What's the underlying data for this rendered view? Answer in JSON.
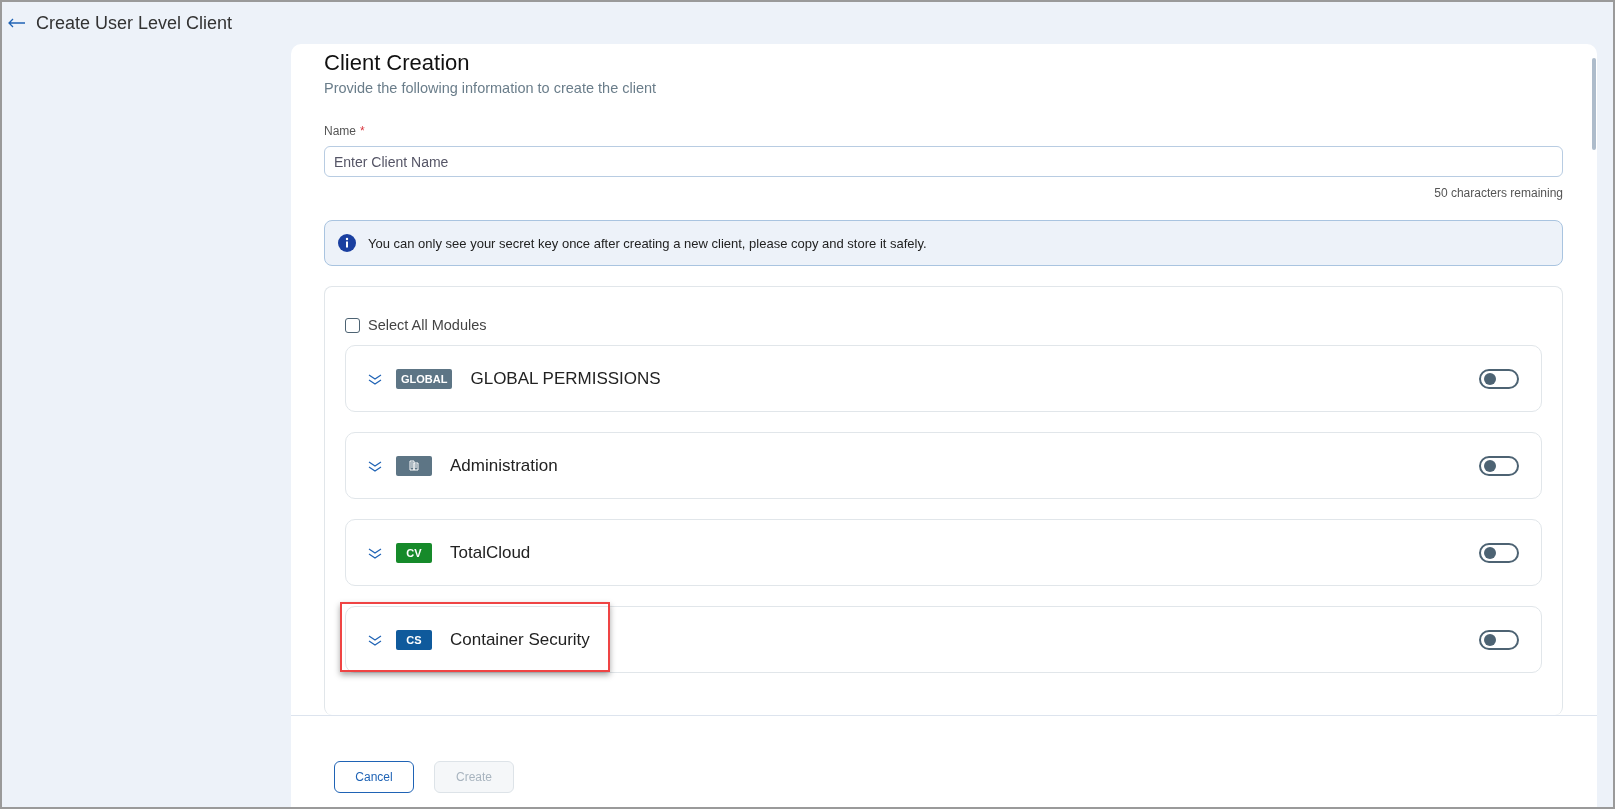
{
  "header": {
    "title": "Create User Level Client"
  },
  "form": {
    "title": "Client Creation",
    "subtitle": "Provide the following information to create the client",
    "name_field": {
      "label": "Name",
      "required_mark": "*",
      "placeholder": "Enter Client Name",
      "counter": "50 characters remaining"
    },
    "info": "You can only see your secret key once after creating a new client, please copy and store it safely."
  },
  "modules": {
    "select_all": {
      "label": "Select All Modules",
      "checked": false
    },
    "items": [
      {
        "kind": "text",
        "badge": "GLOBAL",
        "color": "#5d7585",
        "name": "GLOBAL PERMISSIONS",
        "on": false,
        "highlighted": false
      },
      {
        "kind": "icon",
        "color": "#5d7585",
        "name": "Administration",
        "on": false,
        "highlighted": false
      },
      {
        "kind": "text",
        "badge": "CV",
        "color": "#168a2a",
        "name": "TotalCloud",
        "on": false,
        "highlighted": false
      },
      {
        "kind": "text",
        "badge": "CS",
        "color": "#0f5a9c",
        "name": "Container Security",
        "on": false,
        "highlighted": true
      }
    ]
  },
  "footer": {
    "buttons": [
      {
        "label": "Cancel",
        "disabled": false
      },
      {
        "label": "Create",
        "disabled": true
      }
    ]
  }
}
